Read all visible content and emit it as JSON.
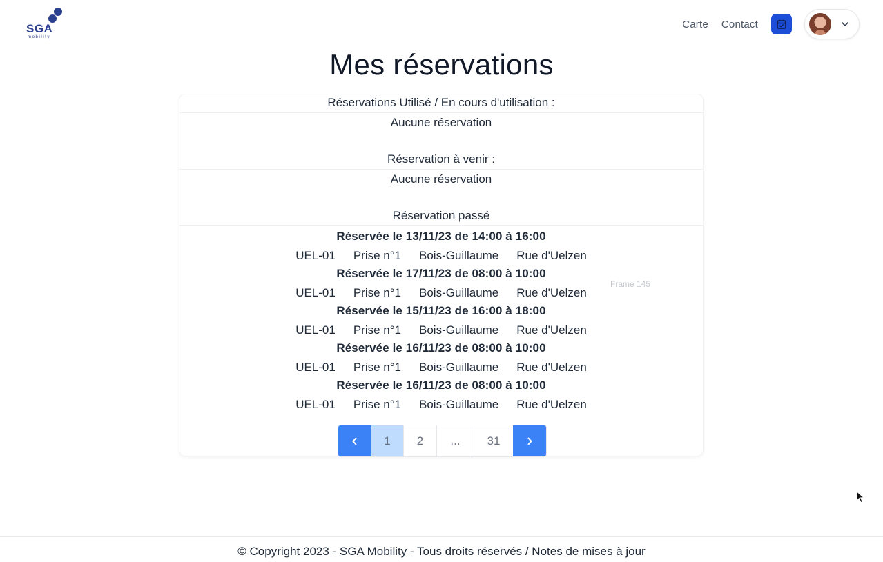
{
  "header": {
    "logo_text": "SGA",
    "logo_subtext": "mobility",
    "nav": [
      "Carte",
      "Contact"
    ],
    "calendar_icon": "calendar-icon",
    "user_menu_icon": "chevron-down-icon"
  },
  "page_title": "Mes réservations",
  "sections": {
    "in_use": {
      "heading": "Réservations Utilisé / En cours d'utilisation :",
      "empty_text": "Aucune réservation"
    },
    "upcoming": {
      "heading": "Réservation à venir :",
      "empty_text": "Aucune réservation"
    },
    "past": {
      "heading": "Réservation passé"
    }
  },
  "reservations": [
    {
      "date": "Réservée le 13/11/23 de 14:00 à 16:00",
      "code": "UEL-01",
      "plug": "Prise n°1",
      "city": "Bois-Guillaume",
      "street": "Rue d'Uelzen"
    },
    {
      "date": "Réservée le 17/11/23 de 08:00 à 10:00",
      "code": "UEL-01",
      "plug": "Prise n°1",
      "city": "Bois-Guillaume",
      "street": "Rue d'Uelzen"
    },
    {
      "date": "Réservée le 15/11/23 de 16:00 à 18:00",
      "code": "UEL-01",
      "plug": "Prise n°1",
      "city": "Bois-Guillaume",
      "street": "Rue d'Uelzen"
    },
    {
      "date": "Réservée le 16/11/23 de 08:00 à 10:00",
      "code": "UEL-01",
      "plug": "Prise n°1",
      "city": "Bois-Guillaume",
      "street": "Rue d'Uelzen"
    },
    {
      "date": "Réservée le 16/11/23 de 08:00 à 10:00",
      "code": "UEL-01",
      "plug": "Prise n°1",
      "city": "Bois-Guillaume",
      "street": "Rue d'Uelzen"
    }
  ],
  "frame_label": "Frame 145",
  "pagination": {
    "prev_label": "‹",
    "next_label": "›",
    "pages": [
      "1",
      "2",
      "...",
      "31"
    ],
    "current": "1"
  },
  "footer": "© Copyright 2023 - SGA Mobility - Tous droits réservés / Notes de mises à jour",
  "colors": {
    "primary": "#3b82f6",
    "calendar_button": "#1d4ed8",
    "active_page": "#bfdbfe",
    "logo": "#2b3f8f"
  }
}
